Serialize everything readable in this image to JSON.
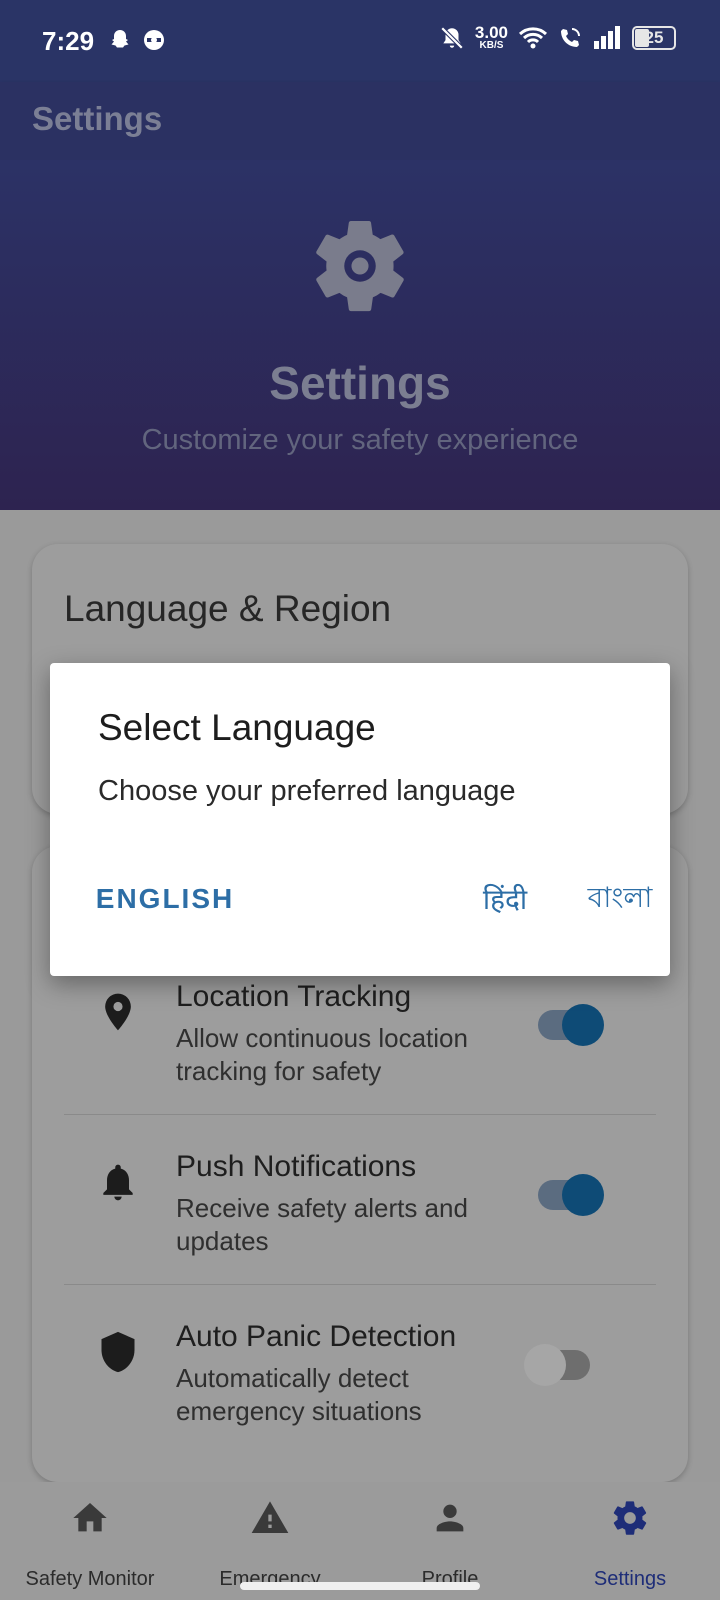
{
  "status_bar": {
    "time": "7:29",
    "network_speed": "3.00",
    "network_unit": "KB/S",
    "battery": "25",
    "icons": [
      "snapchat-icon",
      "vpn-icon",
      "bell-off-icon",
      "wifi-icon",
      "wifi-call-icon",
      "signal-icon",
      "battery-icon"
    ]
  },
  "app_bar": {
    "title": "Settings"
  },
  "header": {
    "icon": "gear-icon",
    "title": "Settings",
    "subtitle": "Customize your safety experience"
  },
  "language_card": {
    "title": "Language & Region"
  },
  "safety_settings": {
    "items": [
      {
        "icon": "location-pin-icon",
        "title": "Location Tracking",
        "description": "Allow continuous location tracking for safety",
        "enabled": true
      },
      {
        "icon": "bell-icon",
        "title": "Push Notifications",
        "description": "Receive safety alerts and updates",
        "enabled": true
      },
      {
        "icon": "shield-icon",
        "title": "Auto Panic Detection",
        "description": "Automatically detect emergency situations",
        "enabled": false
      }
    ]
  },
  "bottom_nav": {
    "items": [
      {
        "label": "Safety Monitor",
        "icon": "home-icon",
        "active": false
      },
      {
        "label": "Emergency",
        "icon": "warning-icon",
        "active": false
      },
      {
        "label": "Profile",
        "icon": "person-icon",
        "active": false
      },
      {
        "label": "Settings",
        "icon": "gear-icon",
        "active": true
      }
    ]
  },
  "dialog": {
    "title": "Select Language",
    "message": "Choose your preferred language",
    "buttons": {
      "english": "ENGLISH",
      "hindi": "हिंदी",
      "bangla": "বাংলা"
    }
  },
  "colors": {
    "accent": "#2d6ea6",
    "header_top": "#2c3266",
    "header_bottom": "#2d2350",
    "toggle_on": "#0e4b76",
    "nav_active": "#1e2d78"
  }
}
